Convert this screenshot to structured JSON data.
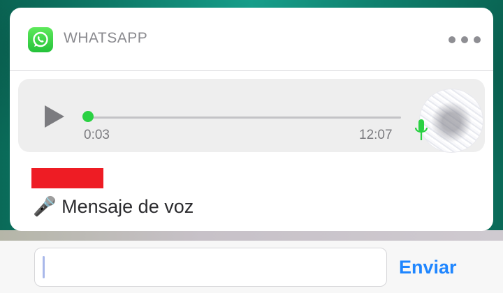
{
  "notification": {
    "app_name": "WHATSAPP",
    "app_icon": "whatsapp-icon",
    "more_icon": "more-horizontal-icon"
  },
  "voice_message": {
    "play_icon": "play-icon",
    "elapsed": "0:03",
    "time": "12:07",
    "progress_fraction": 0.0,
    "mic_icon": "microphone-icon",
    "accent_color": "#2ad142"
  },
  "message": {
    "icon": "microphone-emoji",
    "text": "🎤 Mensaje de voz"
  },
  "reply": {
    "placeholder": "",
    "send_label": "Enviar",
    "send_color": "#1f86ff"
  }
}
